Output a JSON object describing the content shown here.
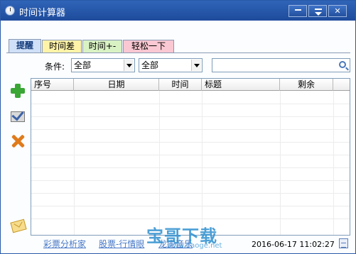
{
  "window": {
    "title": "时间计算器"
  },
  "tabs": [
    {
      "label": "提醒",
      "color": "#cfe0f7"
    },
    {
      "label": "时间差",
      "color": "#fff3a8"
    },
    {
      "label": "时间+-",
      "color": "#d9f2c4"
    },
    {
      "label": "轻松一下",
      "color": "#f9c8d2"
    }
  ],
  "filter": {
    "label": "条件:",
    "select1": "全部",
    "select2": "全部",
    "search_value": ""
  },
  "toolbar_icons": [
    "add-icon",
    "edit-icon",
    "delete-icon",
    "mail-icon"
  ],
  "table": {
    "columns": [
      "序号",
      "日期",
      "时间",
      "标题",
      "剩余"
    ],
    "rows": []
  },
  "status": {
    "links": [
      "彩票分析家",
      "股票-行情眼",
      "龙虎音乐"
    ],
    "datetime": "2016-06-17  11:02:27",
    "watermark": "宝哥下载",
    "watermark_sub": "www.baoge.net"
  },
  "colors": {
    "titlebar": "#2a5aa8",
    "link": "#4a79c6"
  }
}
